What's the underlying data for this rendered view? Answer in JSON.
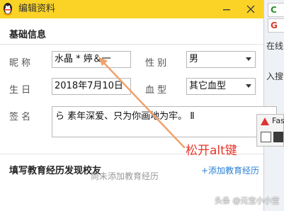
{
  "window": {
    "title": "编辑资料",
    "accent_color": "#fbd327"
  },
  "basic_info": {
    "section_title": "基础信息",
    "nickname": {
      "label": "昵   称",
      "value": "水晶 * 婷＆一"
    },
    "gender": {
      "label": "性   别",
      "value": "男"
    },
    "birthday": {
      "label": "生   日",
      "value": "2018年7月10日"
    },
    "blood_type": {
      "label": "血   型",
      "value": "其它血型"
    },
    "signature": {
      "label": "签   名",
      "value": "ら 素年深爱、只为你画地为牢。 Ⅱ"
    }
  },
  "education": {
    "section_title": "填写教育经历发现校友",
    "add_link": "+添加教育经历",
    "empty_text": "尚未添加教育经历"
  },
  "background_window": {
    "chip_1": "C",
    "chip_2": "G",
    "text_1": "在线",
    "text_2": "入搜索"
  },
  "taskbar_popup": {
    "label": "Fas"
  },
  "annotation": {
    "text": "松开alt键",
    "color": "#e8352a"
  },
  "watermark": "头条 @元宝小小宝"
}
